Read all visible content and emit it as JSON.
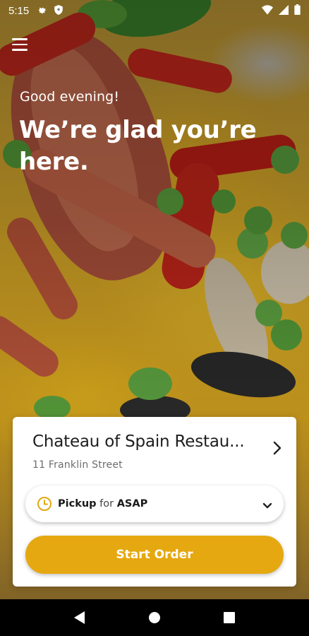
{
  "status_bar": {
    "time": "5:15",
    "left_icons": [
      "gear-icon",
      "shield-icon"
    ],
    "right_icons": [
      "wifi-icon",
      "signal-icon",
      "battery-icon"
    ]
  },
  "header": {
    "menu_icon": "hamburger-menu-icon"
  },
  "hero": {
    "greeting": "Good evening!",
    "headline": "We’re glad you’re here."
  },
  "card": {
    "restaurant_name": "Chateau of Spain Restau...",
    "restaurant_address": "11 Franklin Street",
    "pickup": {
      "mode": "Pickup",
      "connector": "for",
      "time": "ASAP",
      "icon": "clock-icon"
    },
    "start_order_label": "Start Order"
  },
  "nav_bar": {
    "buttons": [
      "back-icon",
      "home-icon",
      "recents-icon"
    ]
  },
  "colors": {
    "accent": "#e5a810",
    "clock_icon": "#e0a812",
    "card_bg": "#ffffff",
    "text_primary": "#1e1e1e",
    "text_secondary": "#6d6d6d"
  }
}
